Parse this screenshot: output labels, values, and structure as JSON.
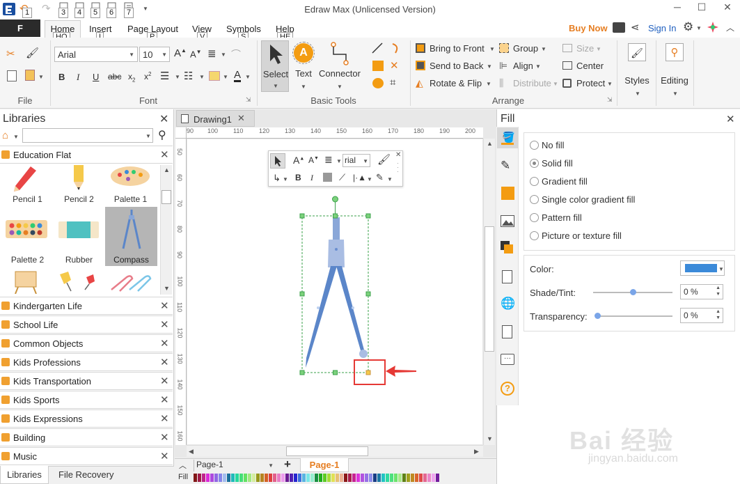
{
  "window": {
    "title": "Edraw Max (Unlicensed Version)"
  },
  "quick_access_keytips": [
    "1",
    "3",
    "4",
    "5",
    "6",
    "7"
  ],
  "menu": {
    "file_label": "F",
    "tabs": [
      {
        "label": "Home",
        "keytip": "HO"
      },
      {
        "label": "Insert",
        "keytip": "I"
      },
      {
        "label": "Page Layout",
        "keytip": "P"
      },
      {
        "label": "View",
        "keytip": "V"
      },
      {
        "label": "Symbols",
        "keytip": "S"
      },
      {
        "label": "Help",
        "keytip": "HE"
      }
    ],
    "buy_now": "Buy Now",
    "sign_in": "Sign In"
  },
  "ribbon": {
    "groups": {
      "file": "File",
      "font": "Font",
      "basic_tools": "Basic Tools",
      "arrange": "Arrange"
    },
    "font_name": "Arial",
    "font_size": "10",
    "tools": {
      "select": "Select",
      "text": "Text",
      "connector": "Connector"
    },
    "arrange": {
      "bring_to_front": "Bring to Front",
      "send_to_back": "Send to Back",
      "rotate_flip": "Rotate & Flip",
      "group": "Group",
      "align": "Align",
      "distribute": "Distribute",
      "size": "Size",
      "center": "Center",
      "protect": "Protect"
    },
    "styles": "Styles",
    "editing": "Editing"
  },
  "libraries": {
    "title": "Libraries",
    "search_placeholder": "",
    "open_library": "Education Flat",
    "shapes": [
      "Pencil 1",
      "Pencil 2",
      "Palette 1",
      "Palette 2",
      "Rubber",
      "Compass"
    ],
    "selected_shape": "Compass",
    "collapsed": [
      "Kindergarten Life",
      "School Life",
      "Common Objects",
      "Kids Professions",
      "Kids Transportation",
      "Kids Sports",
      "Kids Expressions",
      "Building",
      "Music"
    ],
    "bottom_tabs": [
      "Libraries",
      "File Recovery"
    ]
  },
  "document": {
    "tab": "Drawing1",
    "ruler_h": [
      "90",
      "100",
      "110",
      "120",
      "130",
      "140",
      "150",
      "160",
      "170",
      "180",
      "190",
      "200"
    ],
    "ruler_v": [
      "50",
      "60",
      "70",
      "80",
      "90",
      "100",
      "110",
      "120",
      "130",
      "140",
      "150",
      "160"
    ],
    "mini_toolbar_font": "rial",
    "page_select": "Page-1",
    "page_tab": "Page-1",
    "fill_label": "Fill"
  },
  "fill_panel": {
    "title": "Fill",
    "options": [
      "No fill",
      "Solid fill",
      "Gradient fill",
      "Single color gradient fill",
      "Pattern fill",
      "Picture or texture fill"
    ],
    "selected": "Solid fill",
    "color_label": "Color:",
    "color_value": "#3b8ad9",
    "shade_label": "Shade/Tint:",
    "shade_value": "0 %",
    "shade_slider": 0.5,
    "transparency_label": "Transparency:",
    "transparency_value": "0 %",
    "transparency_slider": 0.0
  },
  "colors": {
    "accent_orange": "#e67e22",
    "link_blue": "#1f5fbf",
    "compass_blue": "#5b86c9",
    "highlight_red": "#e53935"
  },
  "watermark": {
    "text": "Bai 经验",
    "url": "jingyan.baidu.com"
  }
}
